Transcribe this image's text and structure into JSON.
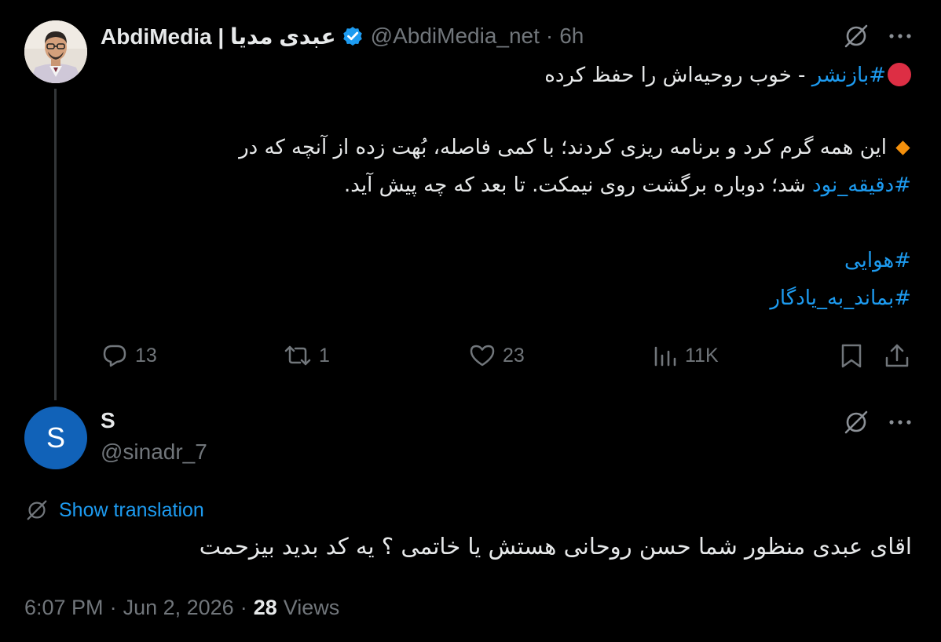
{
  "tweet": {
    "author": {
      "display_name": "AbdiMedia | عبدی مدیا",
      "handle": "@AbdiMedia_net",
      "time": "6h",
      "dot": "·",
      "avatar": "portrait-photo"
    },
    "body": {
      "line1_hashtag": "#بازنشر",
      "line1_text": " - خوب روحیه‌اش را حفظ کرده",
      "line2_text": "این همه گرم کرد و برنامه ریزی کردند؛ با کمی فاصله، بُهت زده از آنچه که در",
      "line3_hashtag": "#دقیقه_نود",
      "line3_text": " شد؛ دوباره برگشت روی نیمکت. تا بعد که چه پیش آید.",
      "hashtag_hava": "#هوایی",
      "hashtag_yadegar": "#بماند_به_یادگار"
    },
    "stats": {
      "replies": "13",
      "reposts": "1",
      "likes": "23",
      "views": "11K"
    },
    "icons": {
      "translate": "no-translate-icon",
      "more": "more-icon",
      "reply": "reply-icon",
      "repost": "repost-icon",
      "like": "heart-icon",
      "views": "views-icon",
      "bookmark": "bookmark-icon",
      "share": "share-icon"
    }
  },
  "reply": {
    "author": {
      "display_name": "S",
      "handle": "@sinadr_7",
      "avatar_letter": "S"
    },
    "show_translation": "Show translation",
    "text": "اقای عبدی منظور شما حسن روحانی هستش یا خاتمی ؟ یه کد بدید بیزحمت",
    "meta": {
      "time": "6:07 PM",
      "date": "Jun 2, 2026",
      "views_count": "28",
      "views_label": "Views",
      "sep": "·"
    }
  },
  "colors": {
    "background": "#000000",
    "text": "#e7e9ea",
    "secondary": "#71767b",
    "accent": "#1d9bf0",
    "avatar_bg": "#1162b8",
    "verified": "#1d9bf0"
  }
}
